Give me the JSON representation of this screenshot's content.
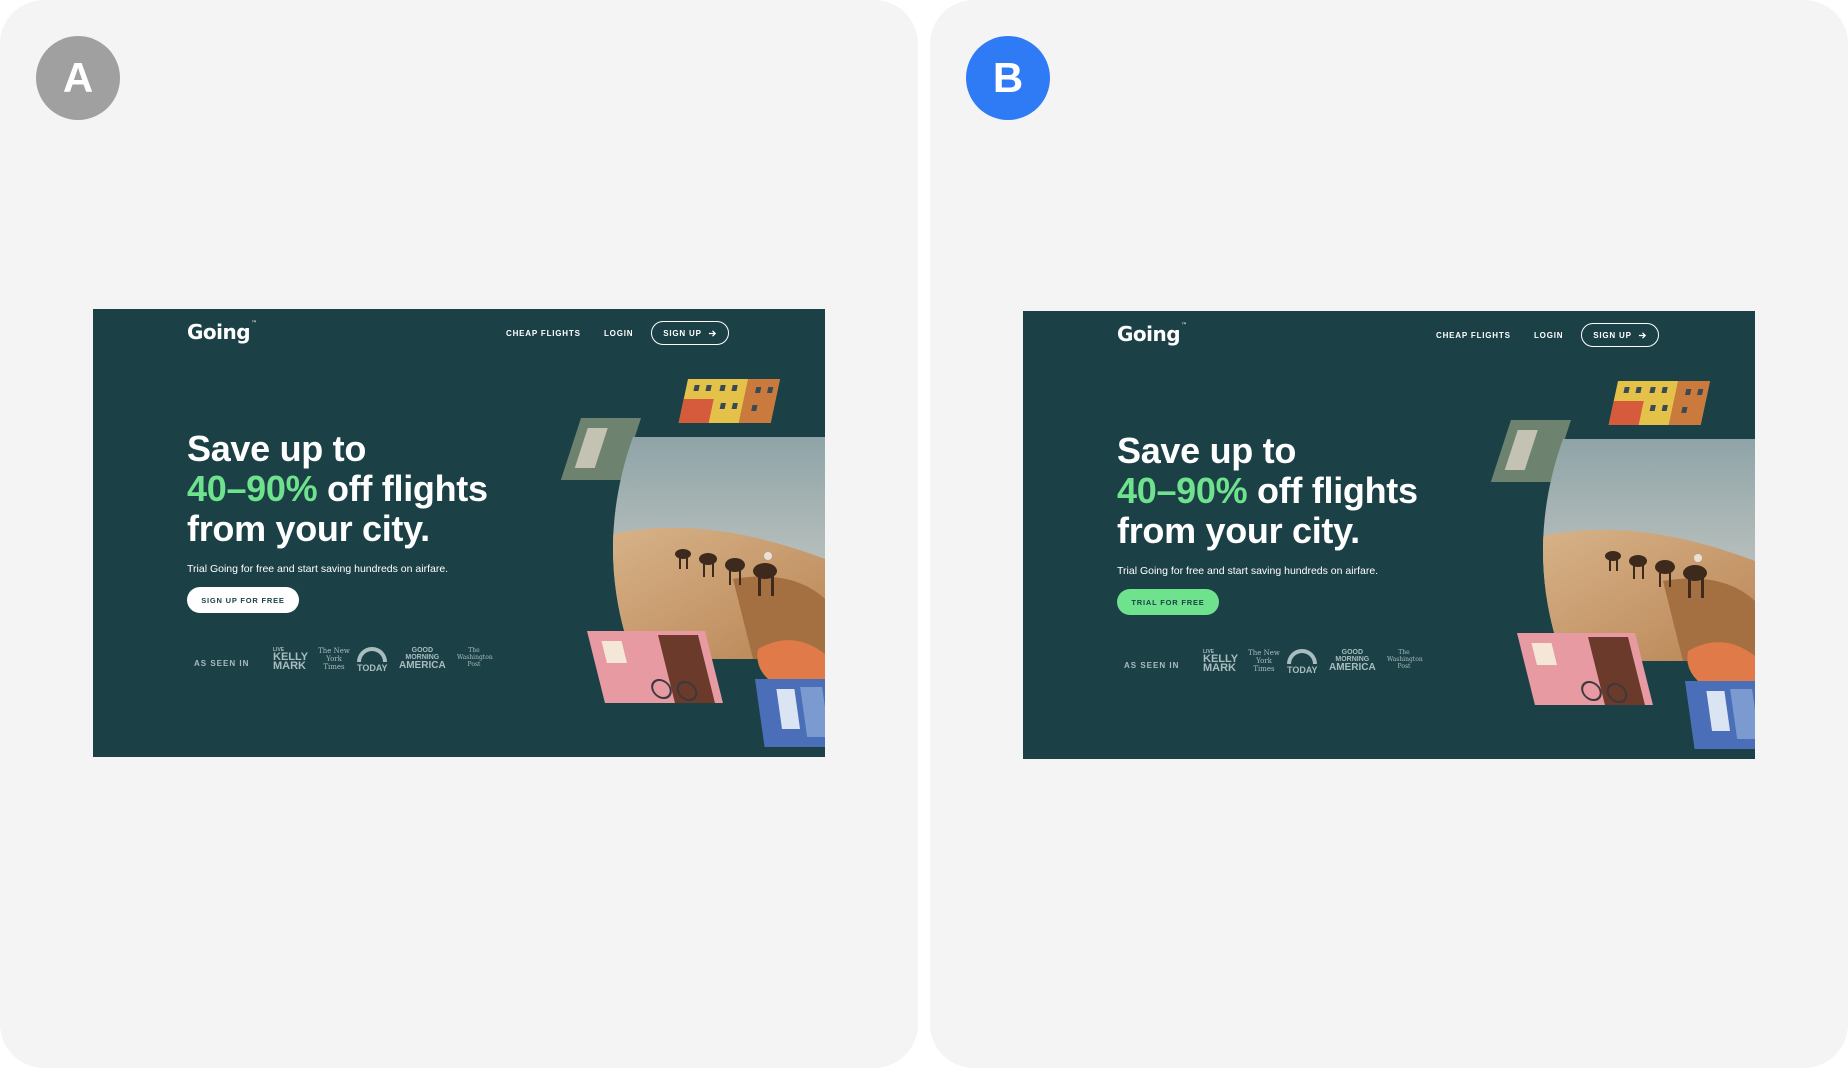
{
  "labels": {
    "a": "A",
    "b": "B"
  },
  "site": {
    "logo": "Going",
    "logo_tm": "™",
    "nav": {
      "cheap_flights": "CHEAP FLIGHTS",
      "login": "LOGIN",
      "signup": "SIGN UP"
    },
    "headline": {
      "line1": "Save up to",
      "accent": "40–90%",
      "line2_rest": " off flights",
      "line3": "from your city."
    },
    "subtext": "Trial Going for free and start saving hundreds on airfare.",
    "as_seen_in": "AS SEEN IN",
    "press": {
      "kelly_live": "LIVE",
      "kelly": "KELLY",
      "mark": "MARK",
      "nyt": "The New York Times",
      "today": "TODAY",
      "gma_good": "GOOD",
      "gma_morning": "MORNING",
      "gma_america": "AMERICA",
      "wp": "The Washington Post"
    }
  },
  "variants": {
    "a": {
      "cta": "SIGN UP FOR FREE",
      "cta_color": "#ffffff"
    },
    "b": {
      "cta": "TRIAL FOR FREE",
      "cta_color": "#6ee28c"
    }
  },
  "colors": {
    "background": "#1b4147",
    "accent": "#6ee28c",
    "badge_a": "#a0a0a0",
    "badge_b": "#2f7bf5"
  }
}
